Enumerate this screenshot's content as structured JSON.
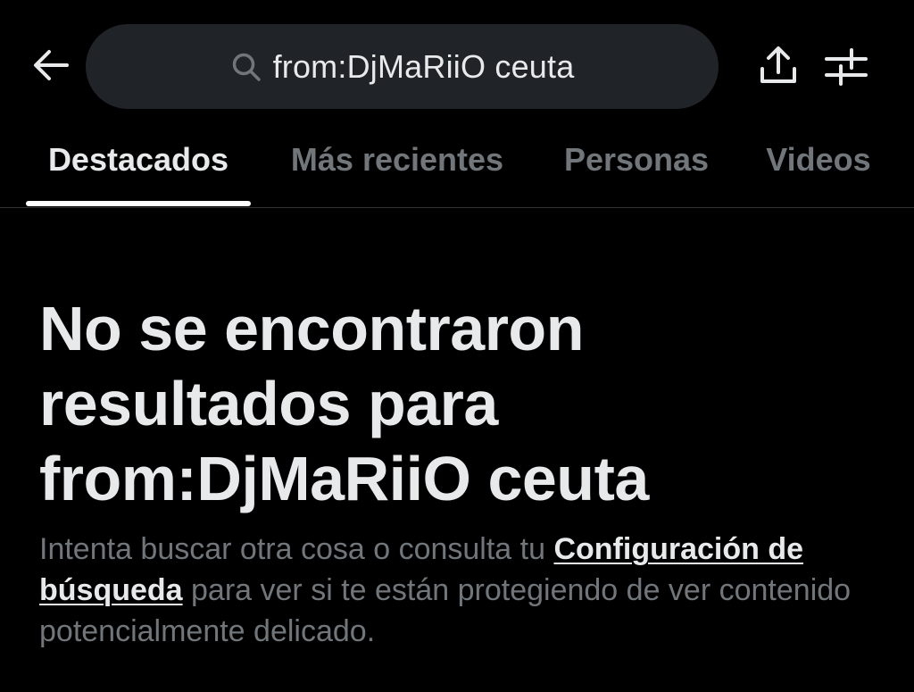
{
  "header": {
    "back_icon": "arrow-left-icon",
    "search_icon": "search-icon",
    "search_query": "from:DjMaRiiO ceuta",
    "share_icon": "share-upload-icon",
    "filter_icon": "filter-sliders-icon"
  },
  "tabs": [
    {
      "label": "Destacados",
      "active": true
    },
    {
      "label": "Más recientes",
      "active": false
    },
    {
      "label": "Personas",
      "active": false
    },
    {
      "label": "Videos",
      "active": false
    }
  ],
  "empty_state": {
    "title_line1": "No se encontraron",
    "title_line2": "resultados para",
    "title_line3": "from:DjMaRiiO ceuta",
    "desc_before_link": "Intenta buscar otra cosa o consulta tu ",
    "link_label": "Configuración de búsqueda",
    "desc_after_link": " para ver si te están protegiendo de ver contenido potencialmente delicado."
  },
  "colors": {
    "background": "#000000",
    "primary_text": "#e7e9ea",
    "secondary_text": "#71767b",
    "search_bg": "#202327",
    "tab_indicator": "#ffffff"
  }
}
